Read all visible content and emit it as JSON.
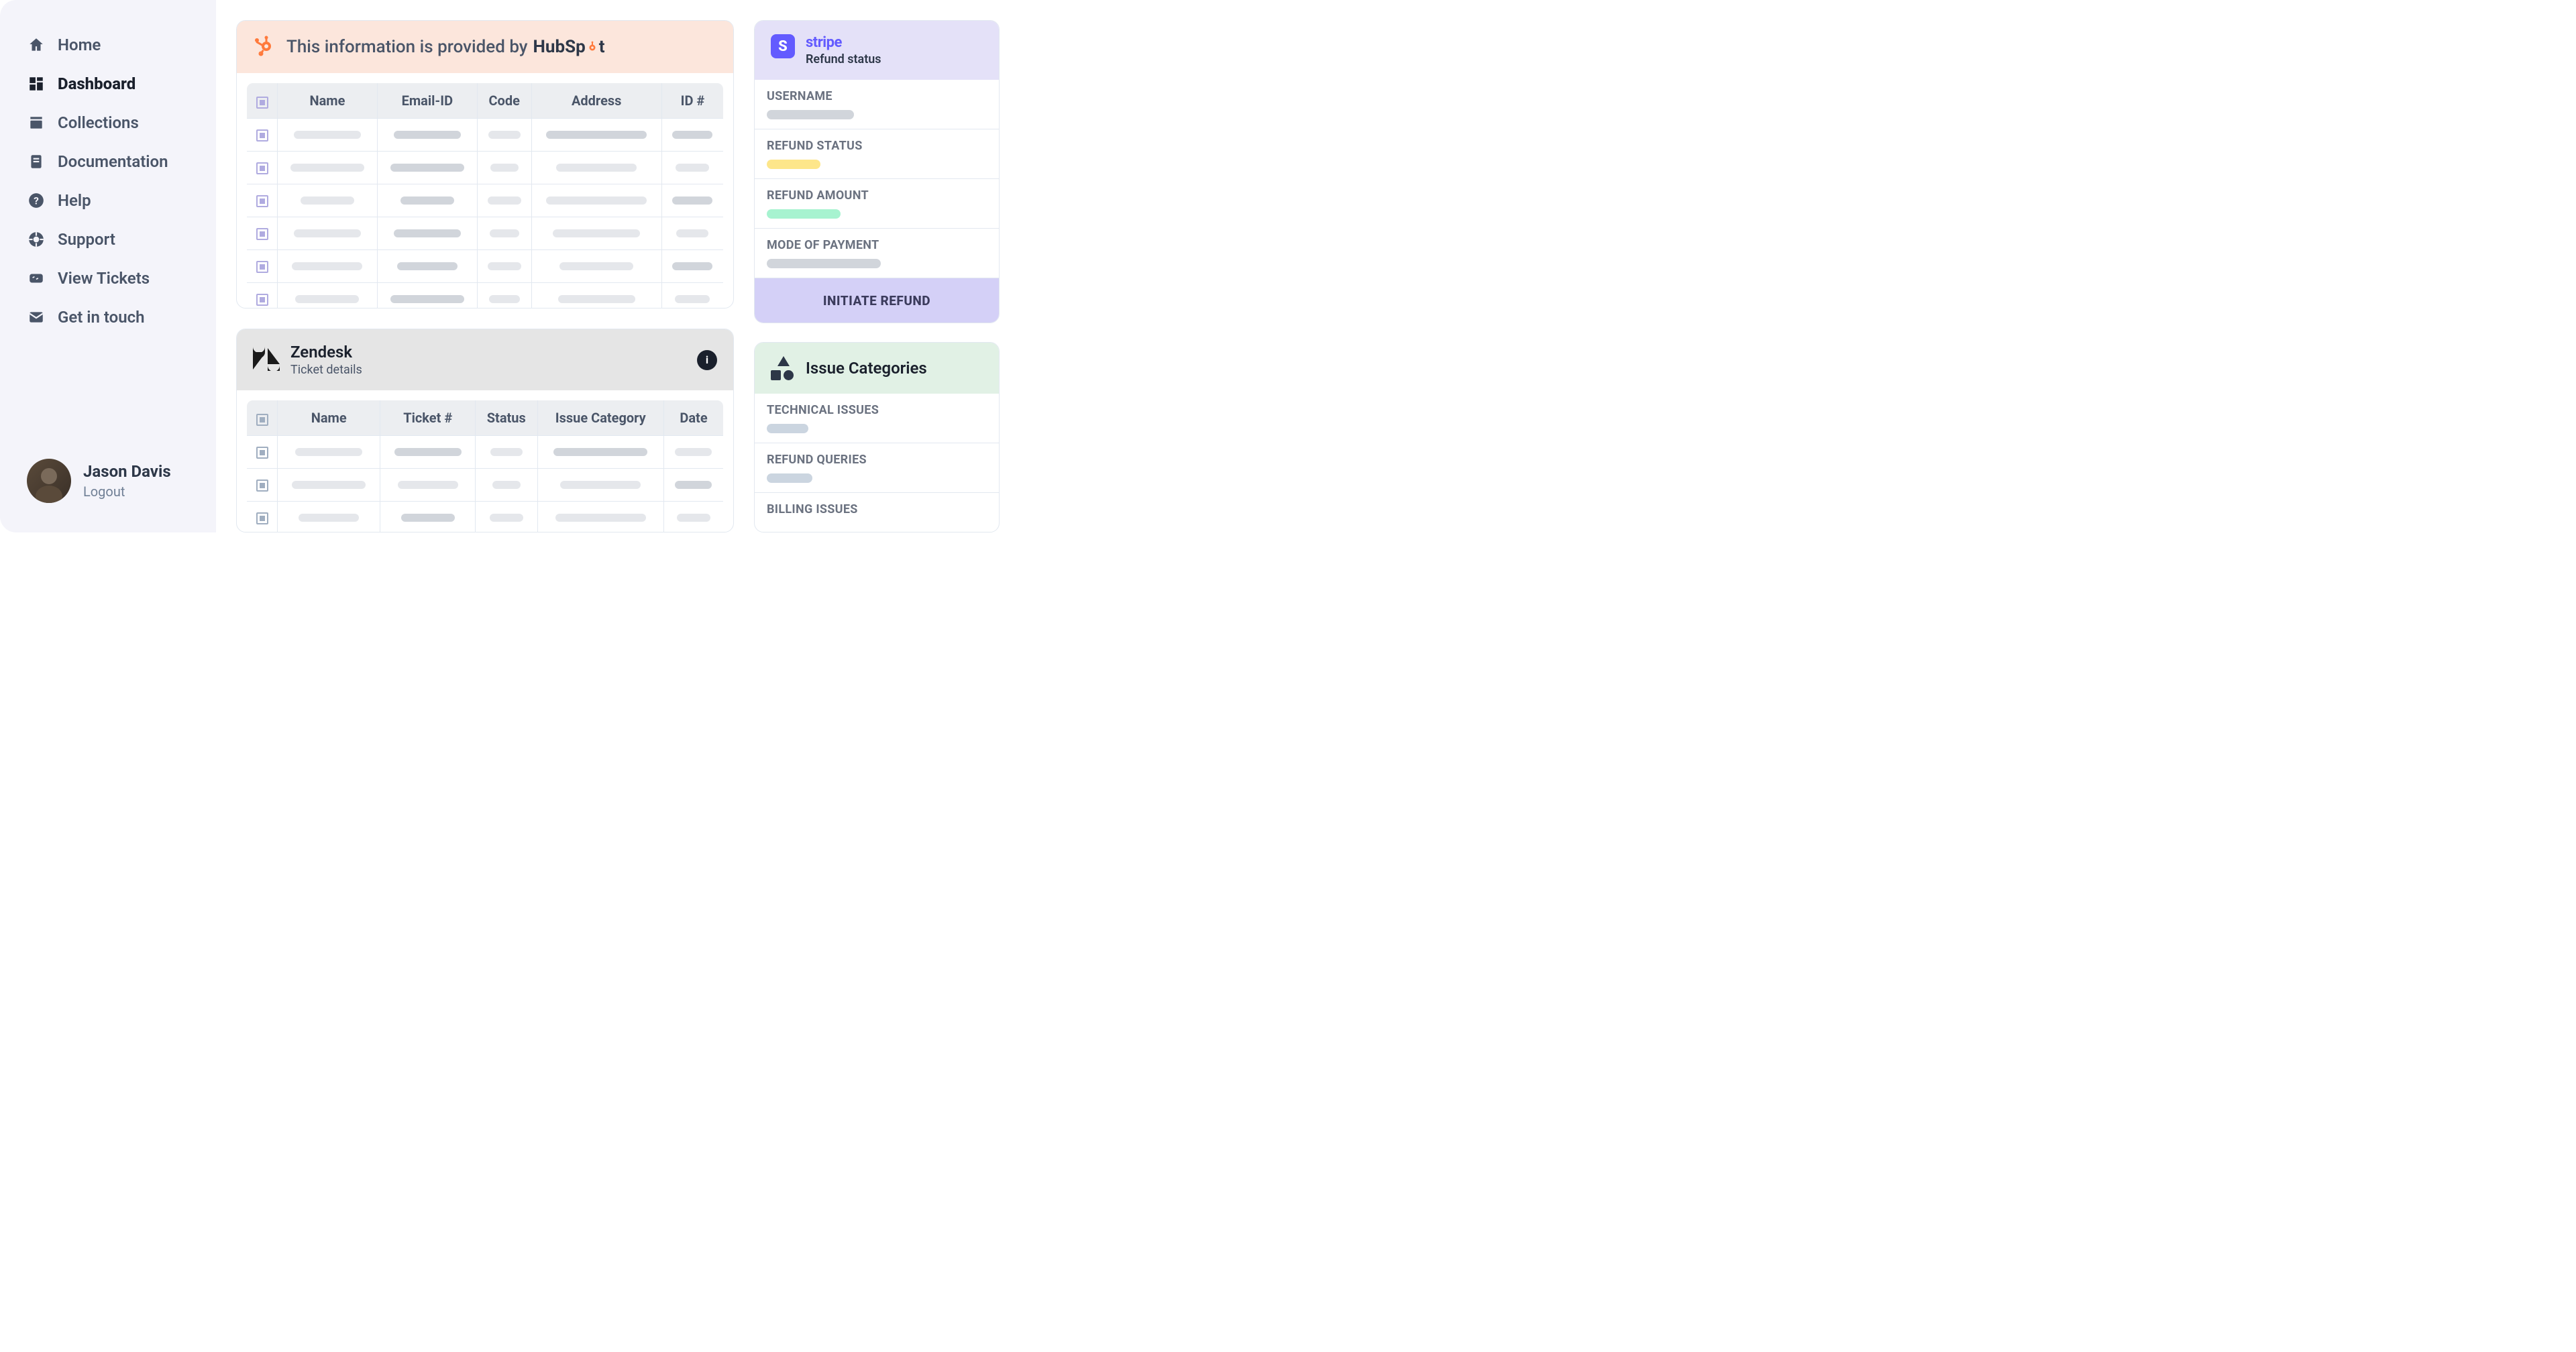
{
  "sidebar": {
    "items": [
      {
        "label": "Home",
        "icon": "home-icon"
      },
      {
        "label": "Dashboard",
        "icon": "dashboard-icon",
        "active": true
      },
      {
        "label": "Collections",
        "icon": "collections-icon"
      },
      {
        "label": "Documentation",
        "icon": "documentation-icon"
      },
      {
        "label": "Help",
        "icon": "help-icon"
      },
      {
        "label": "Support",
        "icon": "support-icon"
      },
      {
        "label": "View Tickets",
        "icon": "tickets-icon"
      },
      {
        "label": "Get in touch",
        "icon": "mail-icon"
      }
    ],
    "user": {
      "name": "Jason Davis",
      "logout_label": "Logout"
    }
  },
  "hubspot_card": {
    "title_prefix": "This information is provided by",
    "brand": "HubSpot",
    "columns": [
      "Name",
      "Email-ID",
      "Code",
      "Address",
      "ID #"
    ],
    "row_count": 6
  },
  "zendesk_card": {
    "brand": "Zendesk",
    "subtitle": "Ticket details",
    "columns": [
      "Name",
      "Ticket #",
      "Status",
      "Issue Category",
      "Date"
    ],
    "row_count": 3
  },
  "stripe_card": {
    "brand": "stripe",
    "subtitle": "Refund status",
    "fields": [
      {
        "label": "USERNAME",
        "bar": "default"
      },
      {
        "label": "REFUND STATUS",
        "bar": "yellow"
      },
      {
        "label": "REFUND AMOUNT",
        "bar": "green"
      },
      {
        "label": "MODE OF PAYMENT",
        "bar": "wide"
      }
    ],
    "cta": "INITIATE REFUND"
  },
  "issues_card": {
    "title": "Issue Categories",
    "fields": [
      {
        "label": "TECHNICAL ISSUES"
      },
      {
        "label": "REFUND QUERIES"
      },
      {
        "label": "BILLING ISSUES"
      }
    ]
  }
}
